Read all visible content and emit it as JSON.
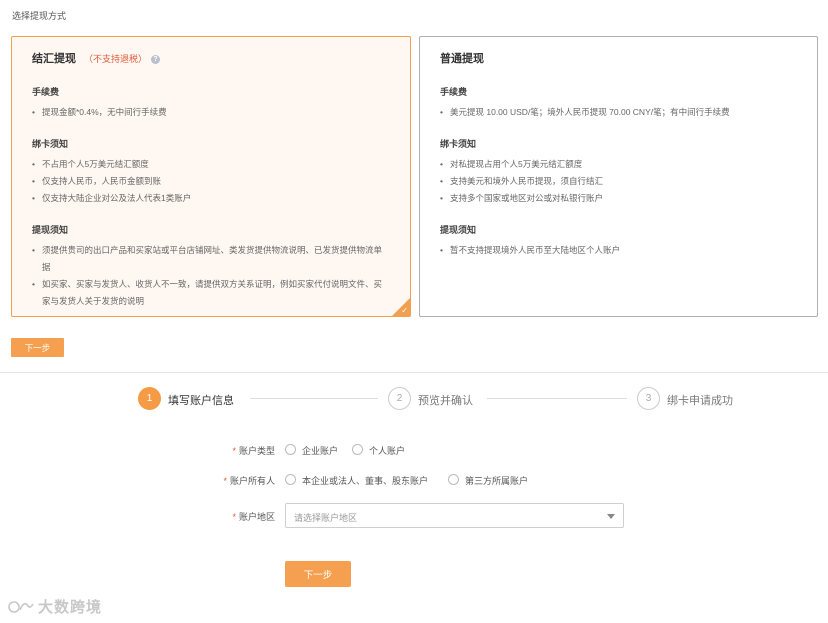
{
  "page": {
    "section_title": "选择提现方式"
  },
  "cards": [
    {
      "title": "结汇提现",
      "note": "（不支持退税）",
      "help_icon": "question-icon",
      "selected": true,
      "groups": [
        {
          "title": "手续费",
          "items": [
            "提现金额*0.4%，无中间行手续费"
          ]
        },
        {
          "title": "绑卡须知",
          "items": [
            "不占用个人5万美元结汇额度",
            "仅支持人民币，人民币金额到账",
            "仅支持大陆企业对公及法人代表1类账户"
          ]
        },
        {
          "title": "提现须知",
          "items": [
            "须提供贵司的出口产品和买家站或平台店铺网址、类发货提供物流说明、已发货提供物流单据",
            "如买家、买家与发货人、收货人不一致，请提供双方关系证明，例如买家代付说明文件、买家与发货人关于发货的说明"
          ]
        }
      ]
    },
    {
      "title": "普通提现",
      "note": "",
      "selected": false,
      "groups": [
        {
          "title": "手续费",
          "items": [
            "美元提现 10.00 USD/笔；境外人民币提现 70.00 CNY/笔；有中间行手续费"
          ]
        },
        {
          "title": "绑卡须知",
          "items": [
            "对私提现占用个人5万美元结汇额度",
            "支持美元和境外人民币提现，须自行结汇",
            "支持多个国家或地区对公或对私银行账户"
          ]
        },
        {
          "title": "提现须知",
          "items": [
            "暂不支持提现境外人民币至大陆地区个人账户"
          ]
        }
      ]
    }
  ],
  "buttons": {
    "next_small": "下一步",
    "next": "下一步"
  },
  "steps": [
    {
      "num": "1",
      "label": "填写账户信息",
      "active": true
    },
    {
      "num": "2",
      "label": "预览并确认",
      "active": false
    },
    {
      "num": "3",
      "label": "绑卡申请成功",
      "active": false
    }
  ],
  "form": {
    "account_type": {
      "label": "账户类型",
      "options": [
        "企业账户",
        "个人账户"
      ]
    },
    "account_owner": {
      "label": "账户所有人",
      "options": [
        "本企业或法人、董事、股东账户",
        "第三方所属账户"
      ]
    },
    "account_region": {
      "label": "账户地区",
      "placeholder": "请选择账户地区"
    }
  },
  "watermark": "大数跨境",
  "colors": {
    "accent": "#f5a050",
    "warning_text": "#e05a3a"
  }
}
